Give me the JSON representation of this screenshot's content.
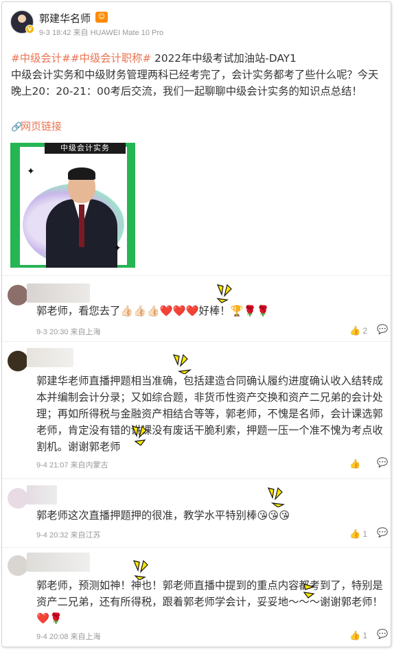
{
  "post": {
    "author": "郭建华名师",
    "meta": "9-3 18:42 来自 HUAWEI Mate 10 Pro",
    "hashtag1": "#中级会计#",
    "hashtag2": "#中级会计职称#",
    "headline": " 2022年中级考试加油站-DAY1",
    "body": "中级会计实务和中级财务管理两科已经考完了，会计实务都考了些什么呢？今天晚上20：20-21：00考后交流，我们一起聊聊中级会计实务的知识点总结！",
    "link_label": "网页链接",
    "image_banner": "中级会计实务"
  },
  "comments": [
    {
      "text": "郭老师，看您去了👍🏻👍🏻👍🏻❤️❤️❤️好棒！🏆🌹🌹",
      "meta": "9-3 20:30 来自上海",
      "likes": "2"
    },
    {
      "text": "郭建华老师直播押题相当准确，包括建造合同确认履约进度确认收入结转成本并编制会计分录；又如综合题，非货币性资产交换和资产二兄弟的会计处理；再如所得税与金融资产相结合等等，郭老师，不愧是名师，会计课选郭老师，肯定没有错的讲课没有废话干脆利索，押题一压一个准不愧为考点收割机。谢谢郭老师",
      "meta": "9-4 21:07 来自内蒙古",
      "likes": ""
    },
    {
      "text": "郭老师这次直播押题押的很准，教学水平特别棒😘😘😘",
      "meta": "9-4 20:32 来自江苏",
      "likes": "1"
    },
    {
      "text": "郭老师，预测如神！神也！郭老师直播中提到的重点内容都考到了，特别是资产二兄弟，还有所得税，跟着郭老师学会计，妥妥地～～～谢谢郭老师！❤️🌹",
      "meta": "9-4 20:08 来自上海",
      "likes": "1"
    }
  ],
  "colors": {
    "accent": "#eb7350",
    "meta_gray": "#999999",
    "text": "#333333"
  }
}
